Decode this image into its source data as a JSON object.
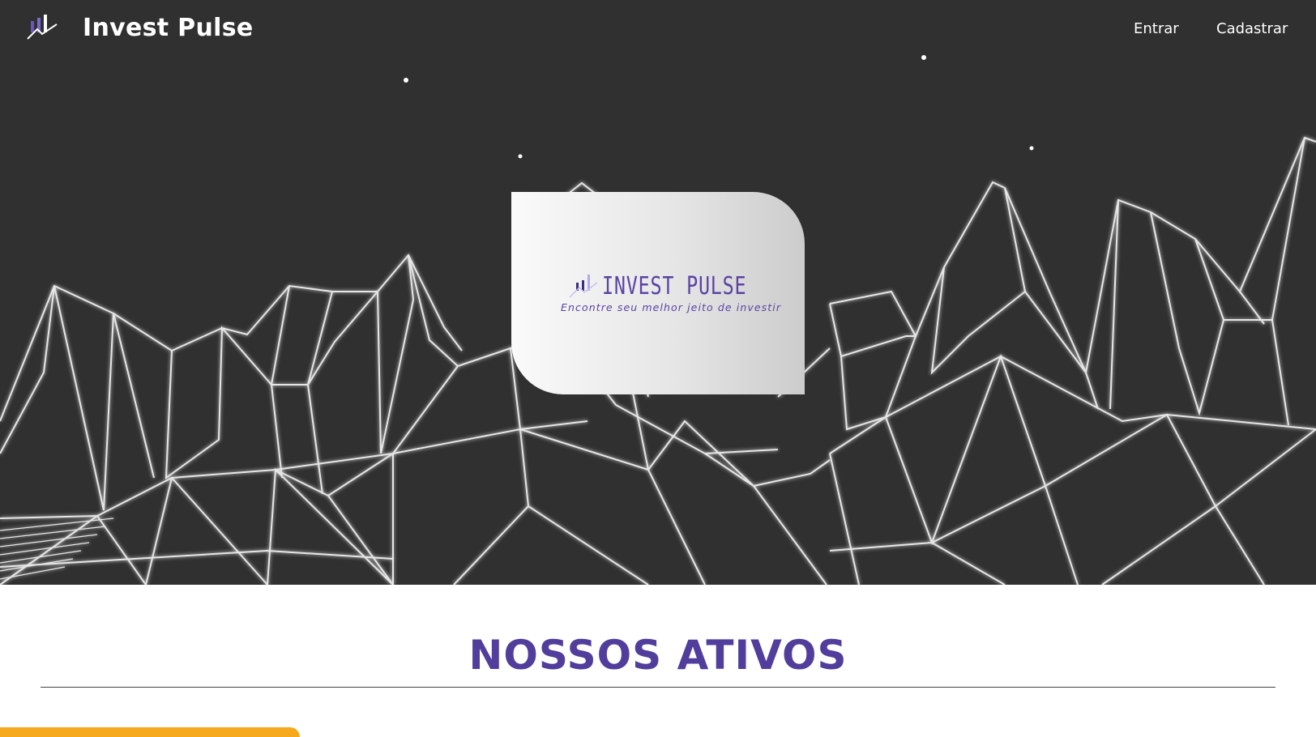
{
  "navbar": {
    "brand": "Invest Pulse",
    "login_label": "Entrar",
    "signup_label": "Cadastrar"
  },
  "hero_card": {
    "title": "INVEST PULSE",
    "tagline": "Encontre seu melhor jeito de investir"
  },
  "section": {
    "title": "NOSSOS ATIVOS"
  },
  "colors": {
    "brand_purple": "#513d9b",
    "hero_background": "#303030",
    "accent": "#f6a91d"
  },
  "icons": [
    "chart-logo-icon"
  ]
}
